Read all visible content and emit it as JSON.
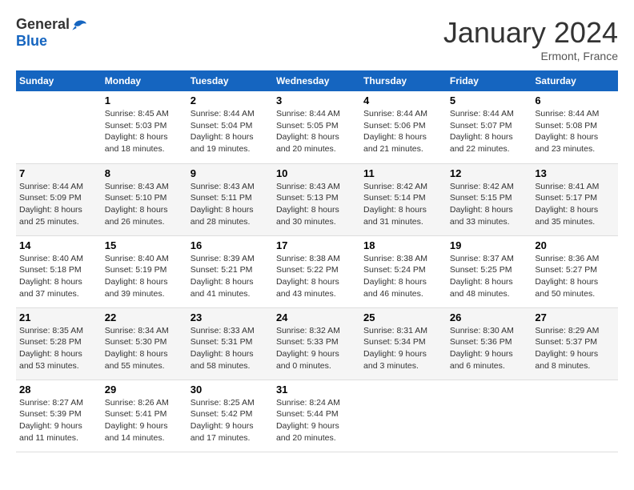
{
  "header": {
    "logo_general": "General",
    "logo_blue": "Blue",
    "month_title": "January 2024",
    "location": "Ermont, France"
  },
  "columns": [
    "Sunday",
    "Monday",
    "Tuesday",
    "Wednesday",
    "Thursday",
    "Friday",
    "Saturday"
  ],
  "weeks": [
    [
      {
        "day": "",
        "info": ""
      },
      {
        "day": "1",
        "info": "Sunrise: 8:45 AM\nSunset: 5:03 PM\nDaylight: 8 hours\nand 18 minutes."
      },
      {
        "day": "2",
        "info": "Sunrise: 8:44 AM\nSunset: 5:04 PM\nDaylight: 8 hours\nand 19 minutes."
      },
      {
        "day": "3",
        "info": "Sunrise: 8:44 AM\nSunset: 5:05 PM\nDaylight: 8 hours\nand 20 minutes."
      },
      {
        "day": "4",
        "info": "Sunrise: 8:44 AM\nSunset: 5:06 PM\nDaylight: 8 hours\nand 21 minutes."
      },
      {
        "day": "5",
        "info": "Sunrise: 8:44 AM\nSunset: 5:07 PM\nDaylight: 8 hours\nand 22 minutes."
      },
      {
        "day": "6",
        "info": "Sunrise: 8:44 AM\nSunset: 5:08 PM\nDaylight: 8 hours\nand 23 minutes."
      }
    ],
    [
      {
        "day": "7",
        "info": "Sunrise: 8:44 AM\nSunset: 5:09 PM\nDaylight: 8 hours\nand 25 minutes."
      },
      {
        "day": "8",
        "info": "Sunrise: 8:43 AM\nSunset: 5:10 PM\nDaylight: 8 hours\nand 26 minutes."
      },
      {
        "day": "9",
        "info": "Sunrise: 8:43 AM\nSunset: 5:11 PM\nDaylight: 8 hours\nand 28 minutes."
      },
      {
        "day": "10",
        "info": "Sunrise: 8:43 AM\nSunset: 5:13 PM\nDaylight: 8 hours\nand 30 minutes."
      },
      {
        "day": "11",
        "info": "Sunrise: 8:42 AM\nSunset: 5:14 PM\nDaylight: 8 hours\nand 31 minutes."
      },
      {
        "day": "12",
        "info": "Sunrise: 8:42 AM\nSunset: 5:15 PM\nDaylight: 8 hours\nand 33 minutes."
      },
      {
        "day": "13",
        "info": "Sunrise: 8:41 AM\nSunset: 5:17 PM\nDaylight: 8 hours\nand 35 minutes."
      }
    ],
    [
      {
        "day": "14",
        "info": "Sunrise: 8:40 AM\nSunset: 5:18 PM\nDaylight: 8 hours\nand 37 minutes."
      },
      {
        "day": "15",
        "info": "Sunrise: 8:40 AM\nSunset: 5:19 PM\nDaylight: 8 hours\nand 39 minutes."
      },
      {
        "day": "16",
        "info": "Sunrise: 8:39 AM\nSunset: 5:21 PM\nDaylight: 8 hours\nand 41 minutes."
      },
      {
        "day": "17",
        "info": "Sunrise: 8:38 AM\nSunset: 5:22 PM\nDaylight: 8 hours\nand 43 minutes."
      },
      {
        "day": "18",
        "info": "Sunrise: 8:38 AM\nSunset: 5:24 PM\nDaylight: 8 hours\nand 46 minutes."
      },
      {
        "day": "19",
        "info": "Sunrise: 8:37 AM\nSunset: 5:25 PM\nDaylight: 8 hours\nand 48 minutes."
      },
      {
        "day": "20",
        "info": "Sunrise: 8:36 AM\nSunset: 5:27 PM\nDaylight: 8 hours\nand 50 minutes."
      }
    ],
    [
      {
        "day": "21",
        "info": "Sunrise: 8:35 AM\nSunset: 5:28 PM\nDaylight: 8 hours\nand 53 minutes."
      },
      {
        "day": "22",
        "info": "Sunrise: 8:34 AM\nSunset: 5:30 PM\nDaylight: 8 hours\nand 55 minutes."
      },
      {
        "day": "23",
        "info": "Sunrise: 8:33 AM\nSunset: 5:31 PM\nDaylight: 8 hours\nand 58 minutes."
      },
      {
        "day": "24",
        "info": "Sunrise: 8:32 AM\nSunset: 5:33 PM\nDaylight: 9 hours\nand 0 minutes."
      },
      {
        "day": "25",
        "info": "Sunrise: 8:31 AM\nSunset: 5:34 PM\nDaylight: 9 hours\nand 3 minutes."
      },
      {
        "day": "26",
        "info": "Sunrise: 8:30 AM\nSunset: 5:36 PM\nDaylight: 9 hours\nand 6 minutes."
      },
      {
        "day": "27",
        "info": "Sunrise: 8:29 AM\nSunset: 5:37 PM\nDaylight: 9 hours\nand 8 minutes."
      }
    ],
    [
      {
        "day": "28",
        "info": "Sunrise: 8:27 AM\nSunset: 5:39 PM\nDaylight: 9 hours\nand 11 minutes."
      },
      {
        "day": "29",
        "info": "Sunrise: 8:26 AM\nSunset: 5:41 PM\nDaylight: 9 hours\nand 14 minutes."
      },
      {
        "day": "30",
        "info": "Sunrise: 8:25 AM\nSunset: 5:42 PM\nDaylight: 9 hours\nand 17 minutes."
      },
      {
        "day": "31",
        "info": "Sunrise: 8:24 AM\nSunset: 5:44 PM\nDaylight: 9 hours\nand 20 minutes."
      },
      {
        "day": "",
        "info": ""
      },
      {
        "day": "",
        "info": ""
      },
      {
        "day": "",
        "info": ""
      }
    ]
  ]
}
